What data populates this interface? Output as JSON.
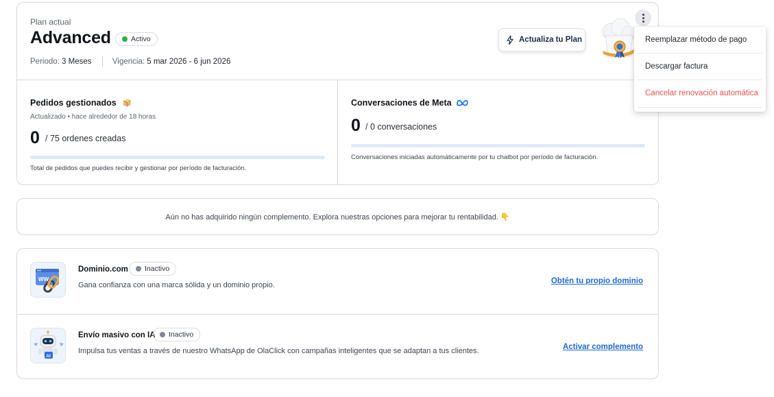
{
  "plan": {
    "label": "Plan actual",
    "name": "Advanced",
    "status": "Activo",
    "period_label": "Periodo:",
    "period_value": "3 Meses",
    "validity_label": "Vigencia:",
    "validity_value": "5 mar 2026 - 6 jun 2026",
    "upgrade_label": "Actualiza tu Plan"
  },
  "menu": {
    "items": [
      {
        "label": "Reemplazar método de pago"
      },
      {
        "label": "Descargar factura"
      },
      {
        "label": "Cancelar renovación automática"
      }
    ]
  },
  "metrics": {
    "orders": {
      "title": "Pedidos gestionados",
      "updated": "Actualizado • hace alrededor de 18 horas",
      "count": "0",
      "rest": "/ 75 ordenes creadas",
      "progress": 0,
      "description": "Total de pedidos que puedes recibir y gestionar por período de facturación."
    },
    "meta": {
      "title": "Conversaciones de Meta",
      "count": "0",
      "rest": "/ 0 conversaciones",
      "progress": 0,
      "description": "Conversaciones iniciadas automáticamente por tu chatbot por período de facturación."
    }
  },
  "addons_notice": {
    "text": "Aún no has adquirido ningún complemento. Explora nuestras opciones para mejorar tu rentabilidad. 👇"
  },
  "addons": [
    {
      "title": "Dominio.com",
      "status": "Inactivo",
      "description": "Gana confianza con una marca sólida y un dominio propio.",
      "link": "Obtén tu propio dominio"
    },
    {
      "title": "Envío masivo con IA",
      "status": "Inactivo",
      "description": "Impulsa tus ventas a través de nuestro WhatsApp de OlaClick con campañas inteligentes que se adaptan a tus clientes.",
      "link": "Activar complemento"
    }
  ],
  "colors": {
    "active_dot": "#2db24a",
    "inactive_dot": "#7d8796",
    "link": "#1e6ad6",
    "danger": "#e0544f",
    "progress_track": "#dfe9f8"
  }
}
